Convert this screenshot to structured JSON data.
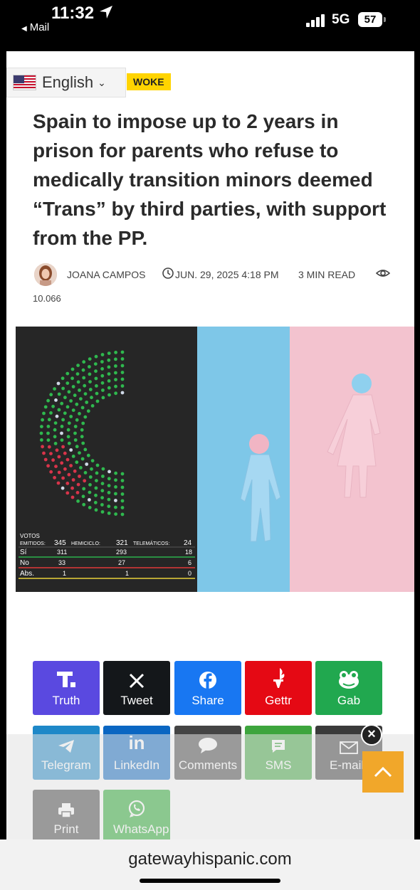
{
  "status_bar": {
    "time": "11:32",
    "back_label": "Mail",
    "network": "5G",
    "battery": "57"
  },
  "language": {
    "label": "English"
  },
  "article": {
    "category": "WOKE",
    "headline": "Spain to impose up to 2 years in prison for parents who refuse to medically transition minors deemed “Trans” by third parties, with support from the PP.",
    "author": "JOANA CAMPOS",
    "date": "JUN. 29, 2025 4:18 PM",
    "read_time": "3 MIN READ",
    "views": "10.066"
  },
  "hero_image": {
    "board": {
      "votos_label": "VOTOS",
      "emitidos_label": "EMITIDOS:",
      "emitidos_value": "345",
      "hemiciclo_label": "HEMICICLO:",
      "hemiciclo_value": "321",
      "telematicos_label": "TELEMÁTICOS:",
      "telematicos_value": "24",
      "rows": [
        {
          "label": "Sí",
          "a": "311",
          "b": "293",
          "c": "18"
        },
        {
          "label": "No",
          "a": "33",
          "b": "27",
          "c": "6"
        },
        {
          "label": "Abs.",
          "a": "1",
          "b": "1",
          "c": "0"
        }
      ]
    }
  },
  "share_buttons": [
    {
      "label": "Truth",
      "color": "#5a49e0",
      "icon": "truth-icon"
    },
    {
      "label": "Tweet",
      "color": "#14171a",
      "icon": "x-icon"
    },
    {
      "label": "Share",
      "color": "#1877f2",
      "icon": "facebook-icon"
    },
    {
      "label": "Gettr",
      "color": "#e50914",
      "icon": "gettr-icon"
    },
    {
      "label": "Gab",
      "color": "#21a84f",
      "icon": "gab-icon"
    },
    {
      "label": "Telegram",
      "color": "#1e88c8",
      "icon": "telegram-icon"
    },
    {
      "label": "LinkedIn",
      "color": "#0a66c2",
      "icon": "linkedin-icon"
    },
    {
      "label": "Comments",
      "color": "#444444",
      "icon": "comment-icon"
    },
    {
      "label": "SMS",
      "color": "#3da53d",
      "icon": "sms-icon"
    },
    {
      "label": "E-mail",
      "color": "#3a3a3a",
      "icon": "email-icon"
    },
    {
      "label": "Print",
      "color": "#444444",
      "icon": "print-icon"
    },
    {
      "label": "WhatsApp",
      "color": "#22a82a",
      "icon": "whatsapp-icon"
    }
  ],
  "browser": {
    "url": "gatewayhispanic.com"
  }
}
